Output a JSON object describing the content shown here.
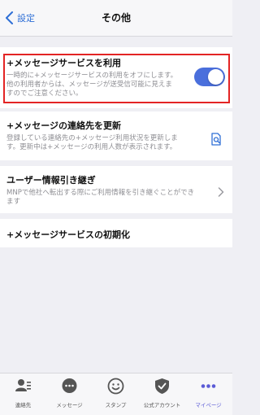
{
  "navbar": {
    "back_label": "設定",
    "title": "その他"
  },
  "settings": {
    "plus_message_usage": {
      "title": "+メッセージサービスを利用",
      "description": [
        "一時的に+メッセージサービスの利用をオフにします。",
        "他の利用者からは、メッセージが送受信可能に見えま",
        "すのでご注意ください。"
      ],
      "toggle_state": "on"
    },
    "update_contacts": {
      "title": "+メッセージの連絡先を更新",
      "description": [
        "登録している連絡先の+メッセージ利用状況を更新しま",
        "す。更新中は+メッセージの利用人数が表示されます。"
      ]
    },
    "user_info_transfer": {
      "title": "ユーザー情報引き継ぎ",
      "description": [
        "MNPで他社へ転出する際にご利用情報を引き継ぐことができ",
        "ます"
      ]
    },
    "initialize": {
      "title": "+メッセージサービスの初期化"
    }
  },
  "tabbar": {
    "tabs": [
      {
        "label": "連絡先",
        "icon": "contacts-icon"
      },
      {
        "label": "メッセージ",
        "icon": "message-icon"
      },
      {
        "label": "スタンプ",
        "icon": "stamp-icon"
      },
      {
        "label": "公式アカウント",
        "icon": "official-account-icon"
      },
      {
        "label": "マイページ",
        "icon": "more-icon",
        "active": true
      }
    ]
  },
  "colors": {
    "accent": "#2f6fd6",
    "toggle_on": "#4a6fdc",
    "highlight": "#e32424",
    "active_tab": "#5b5bd6"
  }
}
